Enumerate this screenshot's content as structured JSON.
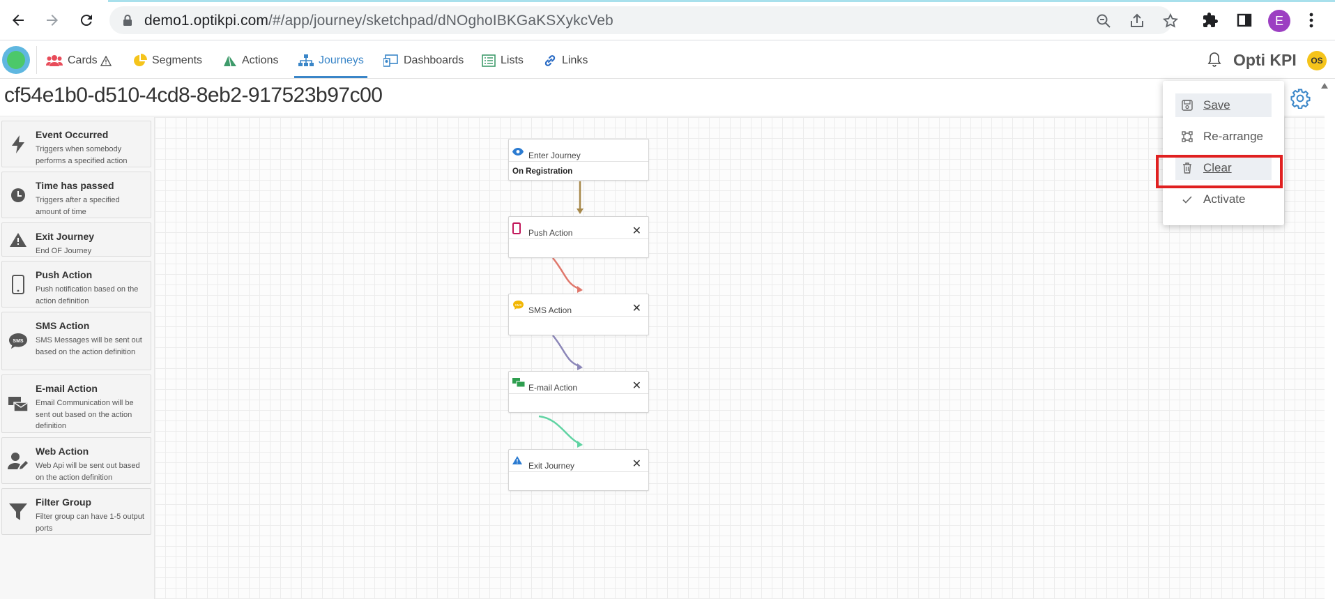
{
  "browser": {
    "url_host": "demo1.optikpi.com",
    "url_path": "/#/app/journey/sketchpad/dNOghoIBKGaKSXykcVeb",
    "profile_initial": "E"
  },
  "nav": {
    "items": [
      {
        "label": "Cards"
      },
      {
        "label": "Segments"
      },
      {
        "label": "Actions"
      },
      {
        "label": "Journeys"
      },
      {
        "label": "Dashboards"
      },
      {
        "label": "Lists"
      },
      {
        "label": "Links"
      }
    ],
    "active": "Journeys",
    "app_name": "Opti KPI",
    "user_initials": "OS"
  },
  "journey": {
    "title": "cf54e1b0-d510-4cd8-8eb2-917523b97c00"
  },
  "palette": [
    {
      "title": "Event Occurred",
      "desc": "Triggers when somebody performs a specified action",
      "icon": "lightning-icon"
    },
    {
      "title": "Time has passed",
      "desc": "Triggers after a specified amount of time",
      "icon": "clock-icon"
    },
    {
      "title": "Exit Journey",
      "desc": "End OF Journey",
      "icon": "warning-icon"
    },
    {
      "title": "Push Action",
      "desc": "Push notification based on the action definition",
      "icon": "mobile-icon"
    },
    {
      "title": "SMS Action",
      "desc": "SMS Messages will be sent out based on the action definition",
      "icon": "sms-icon"
    },
    {
      "title": "E-mail Action",
      "desc": "Email Communication will be sent out based on the action definition",
      "icon": "email-icon"
    },
    {
      "title": "Web Action",
      "desc": "Web Api will be sent out based on the action definition",
      "icon": "user-edit-icon"
    },
    {
      "title": "Filter Group",
      "desc": "Filter group can have 1-5 output ports",
      "icon": "filter-icon"
    }
  ],
  "nodes": [
    {
      "title": "Enter Journey",
      "body": "On Registration",
      "icon": "eye-icon",
      "color": "#2b7bd1"
    },
    {
      "title": "Push Action",
      "body": "",
      "icon": "mobile-icon",
      "color": "#c2185b"
    },
    {
      "title": "SMS Action",
      "body": "",
      "icon": "sms-icon",
      "color": "#f2b705"
    },
    {
      "title": "E-mail Action",
      "body": "",
      "icon": "email-icon",
      "color": "#2e9e4f"
    },
    {
      "title": "Exit Journey",
      "body": "",
      "icon": "warning-icon",
      "color": "#2b7bd1"
    }
  ],
  "link_colors": [
    "#a7884a",
    "#e0776b",
    "#8b86b8",
    "#5fd3a2"
  ],
  "menu": {
    "items": [
      {
        "label": "Save",
        "icon": "save-icon"
      },
      {
        "label": "Re-arrange",
        "icon": "rearrange-icon"
      },
      {
        "label": "Clear",
        "icon": "trash-icon"
      },
      {
        "label": "Activate",
        "icon": "check-icon"
      }
    ]
  }
}
